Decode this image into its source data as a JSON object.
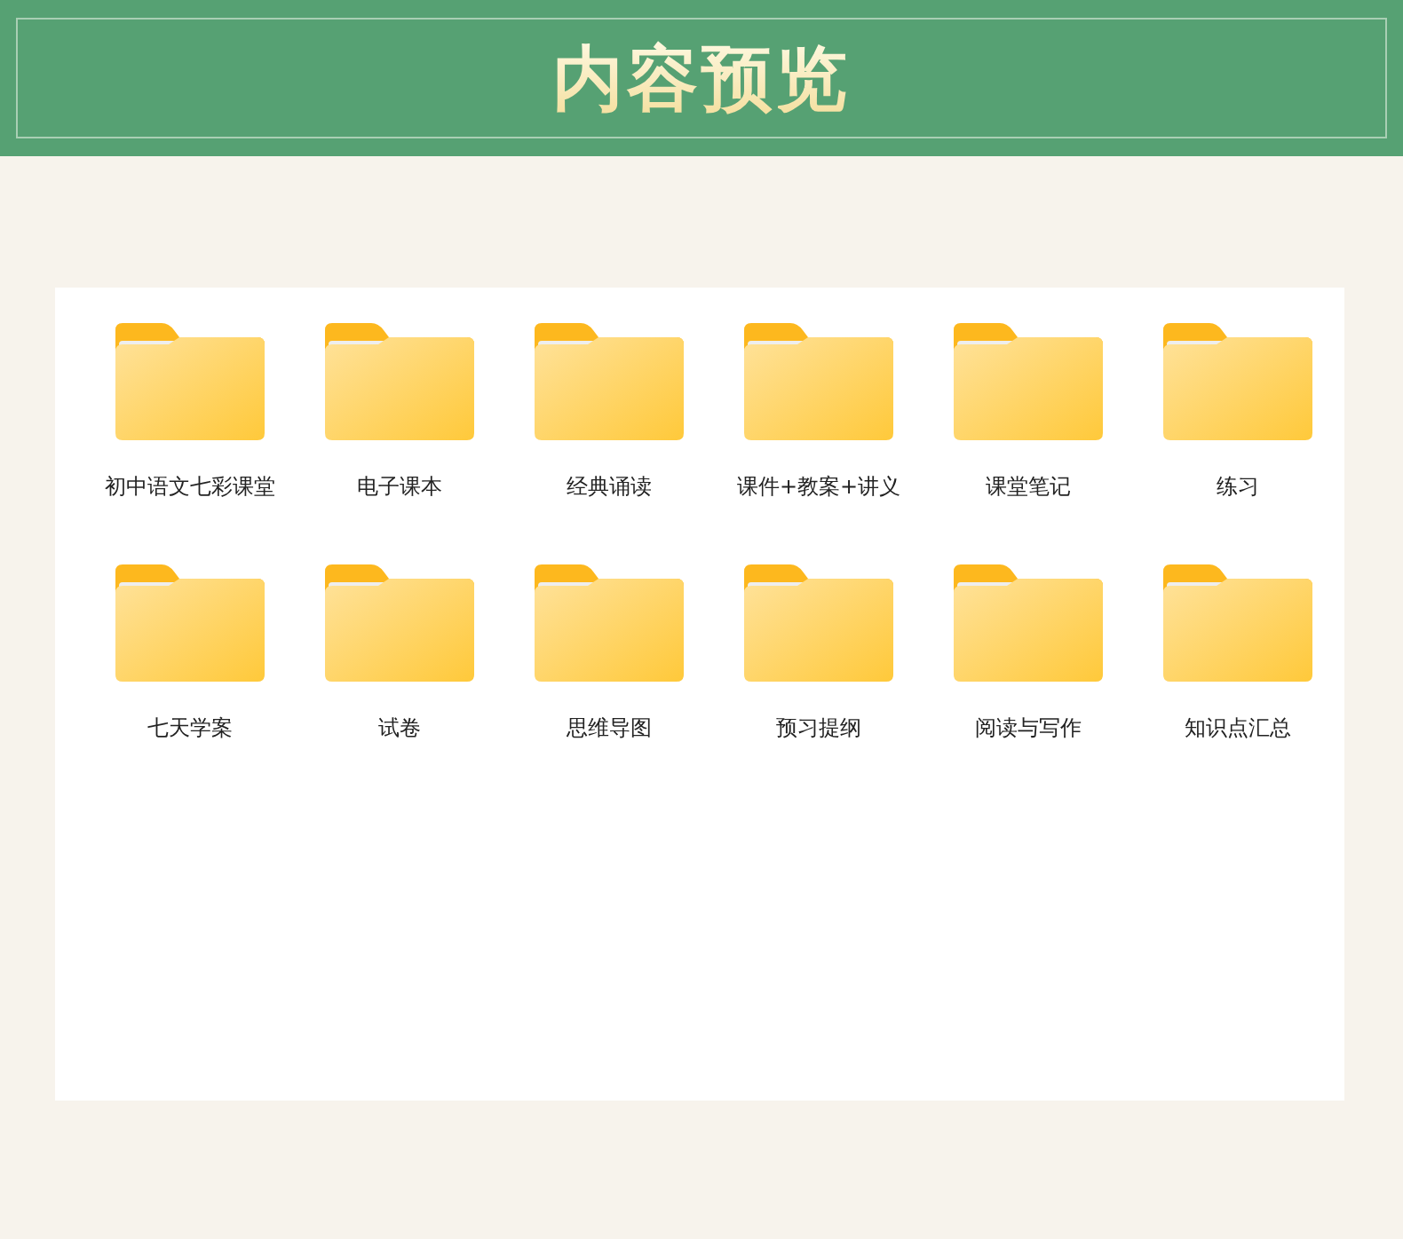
{
  "header": {
    "title": "内容预览"
  },
  "folders": [
    {
      "label": "初中语文七彩课堂"
    },
    {
      "label": "电子课本"
    },
    {
      "label": "经典诵读"
    },
    {
      "label": "课件+教案+讲义"
    },
    {
      "label": "课堂笔记"
    },
    {
      "label": "练习"
    },
    {
      "label": "七天学案"
    },
    {
      "label": "试卷"
    },
    {
      "label": "思维导图"
    },
    {
      "label": "预习提纲"
    },
    {
      "label": "阅读与写作"
    },
    {
      "label": "知识点汇总"
    }
  ]
}
